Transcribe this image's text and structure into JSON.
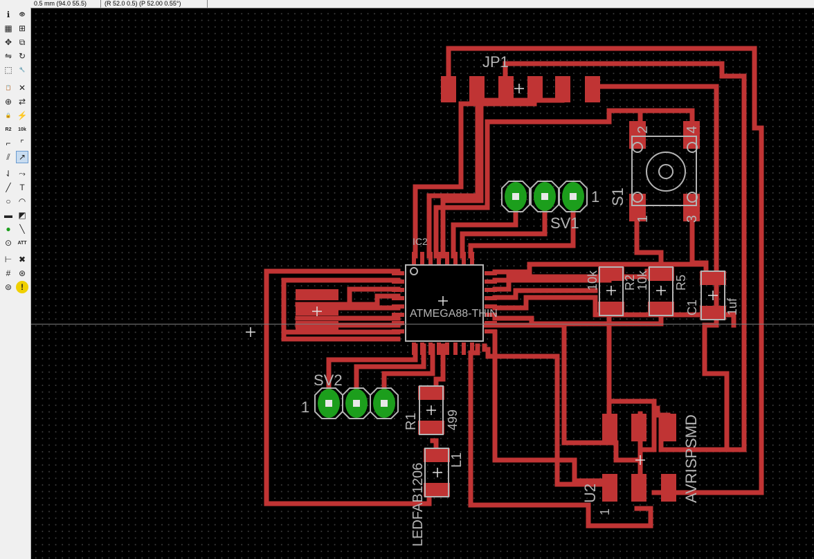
{
  "status": {
    "coordinates": "0.5 mm (94.0 55.5)",
    "polar": "(R 52.0 0.5) (P 52.00 0.55°)"
  },
  "toolbar": {
    "tools": [
      {
        "name": "info",
        "glyph": "ℹ"
      },
      {
        "name": "show",
        "glyph": "👁"
      },
      {
        "name": "display",
        "glyph": "▦"
      },
      {
        "name": "mark",
        "glyph": "⊞"
      },
      {
        "name": "move",
        "glyph": "✥"
      },
      {
        "name": "copy",
        "glyph": "⧉"
      },
      {
        "name": "mirror",
        "glyph": "⇋"
      },
      {
        "name": "rotate",
        "glyph": "↻"
      },
      {
        "name": "group",
        "glyph": "⬚"
      },
      {
        "name": "change",
        "glyph": "🔧"
      },
      {
        "name": "paste",
        "glyph": "📋"
      },
      {
        "name": "delete",
        "glyph": "✕"
      },
      {
        "name": "add",
        "glyph": "⊕"
      },
      {
        "name": "replace",
        "glyph": "⇄"
      },
      {
        "name": "lock",
        "glyph": "🔒"
      },
      {
        "name": "smash",
        "glyph": "⚡"
      },
      {
        "name": "name",
        "glyph": "R2"
      },
      {
        "name": "value",
        "glyph": "10k"
      },
      {
        "name": "split",
        "glyph": "⌐"
      },
      {
        "name": "miter",
        "glyph": "⌜"
      },
      {
        "name": "optimize",
        "glyph": "⫽"
      },
      {
        "name": "route",
        "glyph": "↗"
      },
      {
        "name": "ripup",
        "glyph": "⇃"
      },
      {
        "name": "autoroute",
        "glyph": "⤳"
      },
      {
        "name": "wire",
        "glyph": "╱"
      },
      {
        "name": "text",
        "glyph": "T"
      },
      {
        "name": "circle",
        "glyph": "○"
      },
      {
        "name": "arc",
        "glyph": "◠"
      },
      {
        "name": "rect",
        "glyph": "▬"
      },
      {
        "name": "polygon",
        "glyph": "◩"
      },
      {
        "name": "via",
        "glyph": "●"
      },
      {
        "name": "signal",
        "glyph": "╲"
      },
      {
        "name": "hole",
        "glyph": "⊙"
      },
      {
        "name": "attribute",
        "glyph": "ATT"
      },
      {
        "name": "dimension",
        "glyph": "⊢"
      },
      {
        "name": "ratsnest",
        "glyph": "✖"
      },
      {
        "name": "auto",
        "glyph": "#"
      },
      {
        "name": "drc",
        "glyph": "⊛"
      },
      {
        "name": "errors",
        "glyph": "⊜"
      },
      {
        "name": "stop",
        "glyph": "!"
      }
    ]
  },
  "board": {
    "copper_color": "#c03434",
    "pad_color": "#c03434",
    "via_color": "#1c9e1c",
    "label_color": "#b4b4b4",
    "labels": {
      "jp1": "JP1",
      "sv1": "SV1",
      "sv1_pin": "1",
      "sv2": "SV2",
      "sv2_pin": "1",
      "ic2": "IC2",
      "ic2_value": "ATMEGA88-THIN",
      "s1": "S1",
      "s1_p1": "1",
      "s1_p2": "2",
      "s1_p3": "3",
      "s1_p4": "4",
      "r2": "R2",
      "r2_value": "10k",
      "r5": "R5",
      "r5_value": "10k",
      "c1": "C1",
      "c1_value": "1uf",
      "r1": "R1",
      "r1_value": "499",
      "l1": "L1",
      "l1_value": "LEDFAB1206",
      "u2": "U2",
      "u2_pin": "1",
      "u2_value": "AVRISPSMD"
    }
  }
}
